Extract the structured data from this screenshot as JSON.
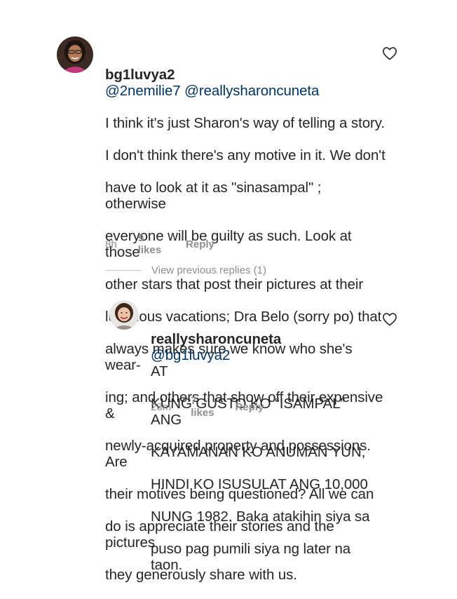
{
  "comments": [
    {
      "username": "bg1luvya2",
      "mentions": "@2nemilie7 @reallysharoncuneta",
      "lines": [
        "I think it's just Sharon's way of telling a story.",
        "I don't think there's any motive in it. We don't",
        "have to look at it as \"sinasampal\" ; otherwise",
        "everyone will be guilty as such. Look at those",
        "other stars that post their pictures at their",
        "luxurious vacations; Dra Belo (sorry po) that",
        "always makes sure we know who she's wear-",
        "ing; and others that show off their expensive &",
        "newly-acquired property and possessions. Are",
        "their motives being questioned? All we can",
        "do is appreciate their stories and the pictures",
        "they generously share with us."
      ],
      "time": "8h",
      "likes": "9 likes",
      "reply": "Reply",
      "avatar_icon": "user-avatar-woman-glasses"
    },
    {
      "username": "reallysharoncuneta",
      "mentions": "@bg1luvya2",
      "first_line_rest": "AT",
      "lines": [
        "KUNG GUSTO KO “ISAMPAL” ANG",
        "KAYAMANAN KO ANUMAN YUN,",
        "HINDI KO ISUSULAT ANG 10,000",
        "NUNG 1982. Baka atakihin siya sa",
        "puso pag pumili siya ng later na taon."
      ],
      "time": "28m",
      "likes": "7 likes",
      "reply": "Reply",
      "avatar_icon": "user-avatar-woman-smiling"
    }
  ],
  "view_previous_replies": "View previous replies (1)",
  "colors": {
    "text": "#262626",
    "mention": "#003569",
    "muted": "#8e8e8e",
    "divider": "#c7c7c7"
  }
}
